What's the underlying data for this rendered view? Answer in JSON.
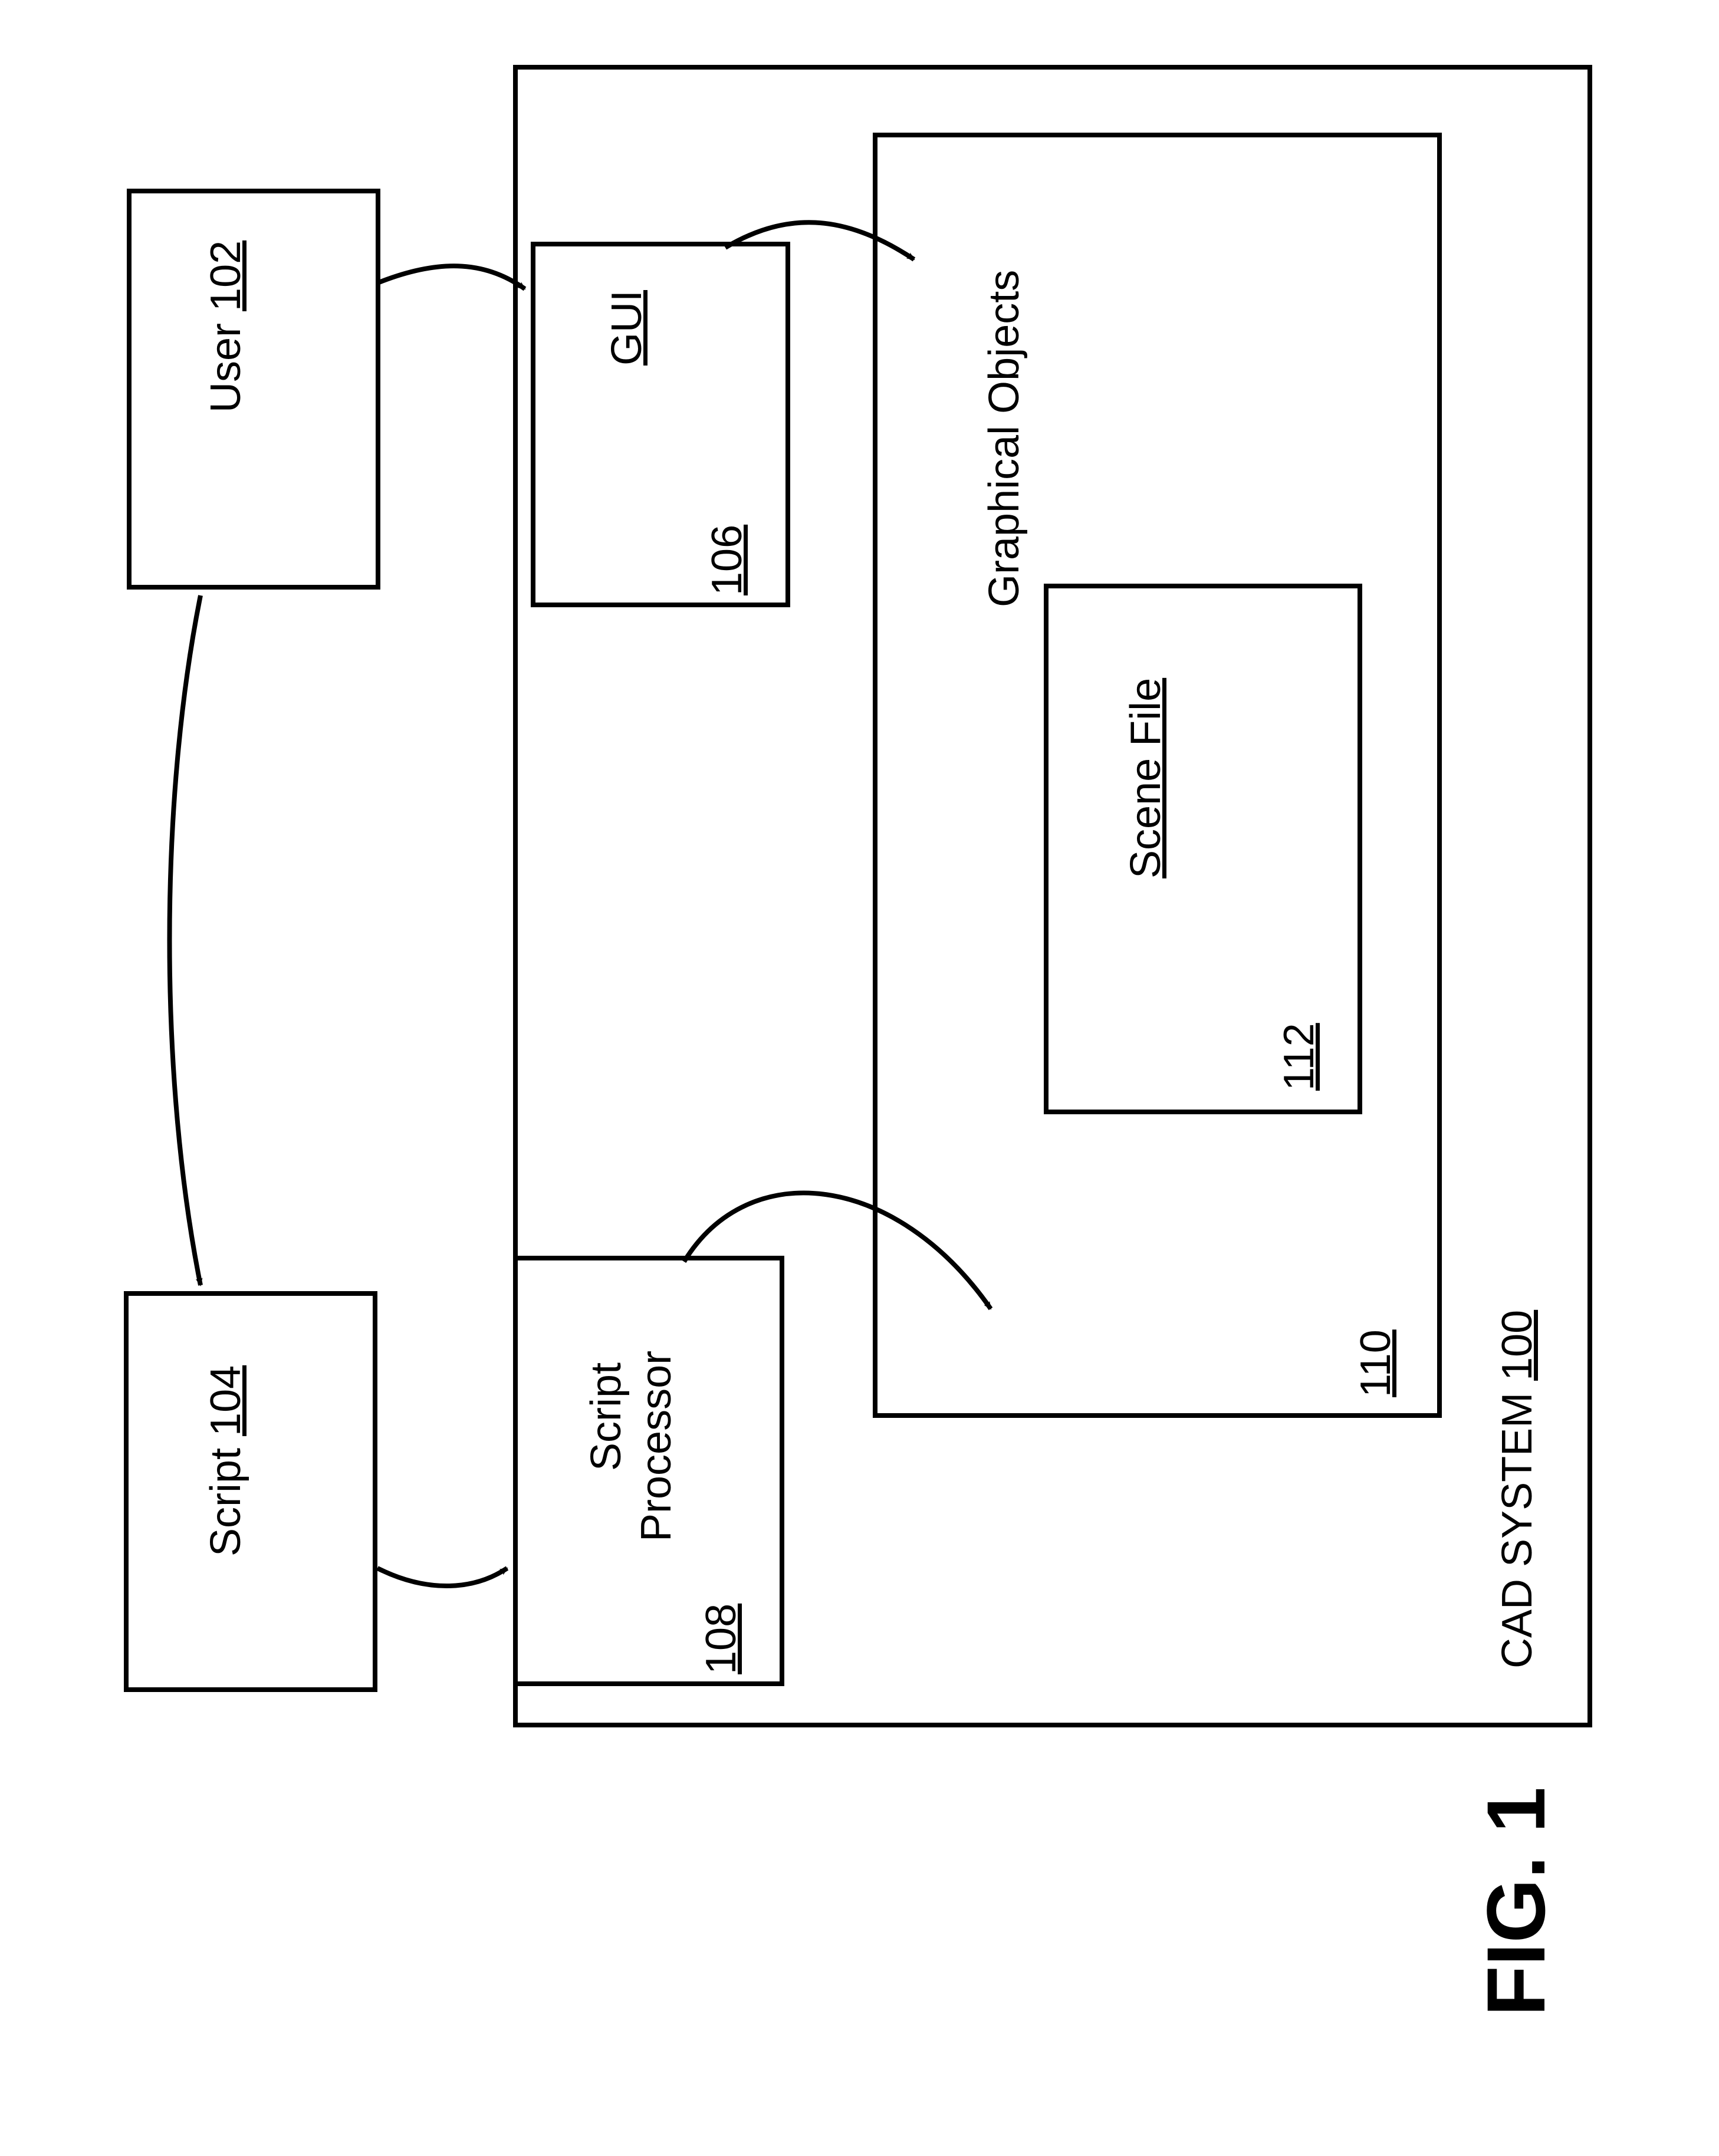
{
  "figure_label": "FIG. 1",
  "boxes": {
    "user": {
      "text": "User",
      "ref": "102"
    },
    "script": {
      "text": "Script",
      "ref": "104"
    },
    "gui": {
      "text": "GUI",
      "ref": "106"
    },
    "script_processor_line1": "Script",
    "script_processor_line2": "Processor",
    "script_processor_ref": "108",
    "graphical_objects": {
      "text": "Graphical Objects",
      "ref": "110"
    },
    "scene_file": {
      "text": "Scene File",
      "ref": "112"
    },
    "cad_system": {
      "text": "CAD SYSTEM ",
      "ref": "100"
    }
  },
  "chart_data": {
    "type": "diagram",
    "title": "FIG. 1",
    "nodes": [
      {
        "id": "user",
        "label": "User",
        "ref": "102"
      },
      {
        "id": "script",
        "label": "Script",
        "ref": "104"
      },
      {
        "id": "gui",
        "label": "GUI",
        "ref": "106"
      },
      {
        "id": "script_processor",
        "label": "Script Processor",
        "ref": "108"
      },
      {
        "id": "graphical_objects",
        "label": "Graphical Objects",
        "ref": "110"
      },
      {
        "id": "scene_file",
        "label": "Scene File",
        "ref": "112",
        "parent": "graphical_objects"
      },
      {
        "id": "cad_system",
        "label": "CAD SYSTEM",
        "ref": "100",
        "contains": [
          "gui",
          "script_processor",
          "graphical_objects"
        ]
      }
    ],
    "edges": [
      {
        "from": "user",
        "to": "gui"
      },
      {
        "from": "user",
        "to": "script"
      },
      {
        "from": "script",
        "to": "script_processor"
      },
      {
        "from": "gui",
        "to": "graphical_objects"
      },
      {
        "from": "script_processor",
        "to": "graphical_objects"
      }
    ]
  }
}
